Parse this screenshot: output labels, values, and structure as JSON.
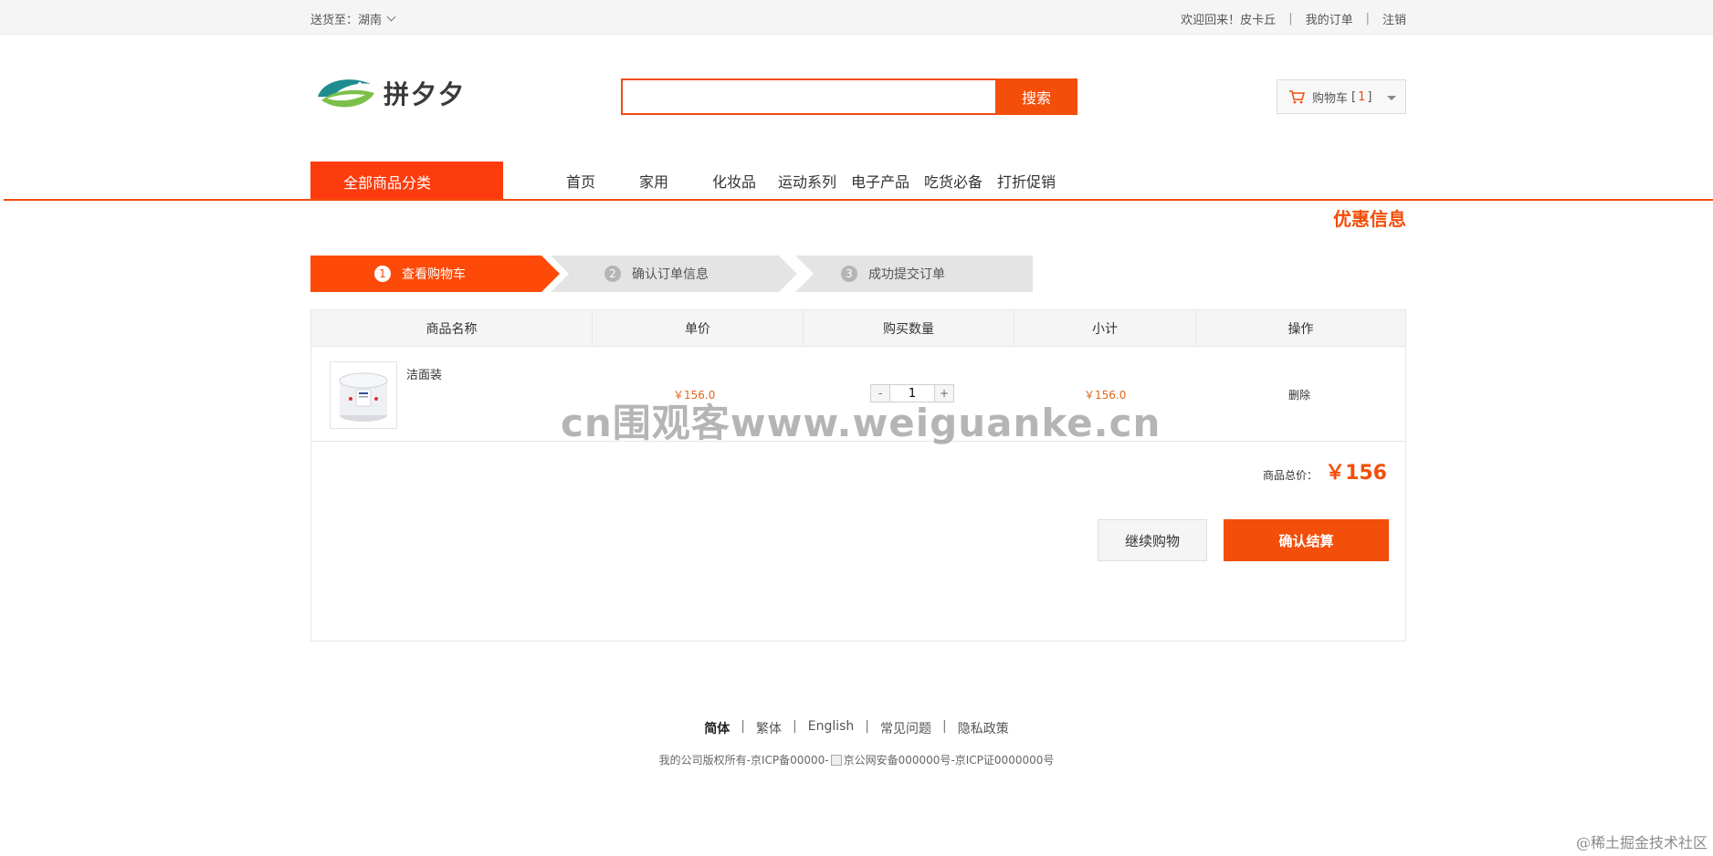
{
  "topbar": {
    "ship_to": "送货至：湖南",
    "welcome": "欢迎回来！皮卡丘",
    "my_orders": "我的订单",
    "logout": "注销",
    "sep": "|"
  },
  "header": {
    "logo_text": "拼夕夕",
    "search_placeholder": "",
    "search_button": "搜索",
    "cart_label": "购物车",
    "cart_count_open": "[",
    "cart_count": "1",
    "cart_count_close": "]"
  },
  "nav": {
    "all_categories": "全部商品分类",
    "items": [
      "首页",
      "家用",
      "化妆品",
      "运动系列",
      "电子产品",
      "吃货必备",
      "打折促销"
    ]
  },
  "promo_title": "优惠信息",
  "steps": [
    {
      "num": "1",
      "label": "查看购物车",
      "active": true
    },
    {
      "num": "2",
      "label": "确认订单信息",
      "active": false
    },
    {
      "num": "3",
      "label": "成功提交订单",
      "active": false
    }
  ],
  "table": {
    "headers": [
      "商品名称",
      "单价",
      "购买数量",
      "小计",
      "操作"
    ],
    "rows": [
      {
        "name": "洁面装",
        "price": "￥156.0",
        "qty": "1",
        "subtotal": "￥156.0",
        "action": "删除"
      }
    ],
    "qty_minus": "-",
    "qty_plus": "+"
  },
  "summary": {
    "total_label": "商品总价：",
    "total_value": "￥156",
    "continue_button": "继续购物",
    "confirm_button": "确认结算"
  },
  "watermark": "cn围观客www.weiguanke.cn",
  "footer": {
    "links": [
      "简体",
      "繁体",
      "English",
      "常见问题",
      "隐私政策"
    ],
    "sep": "|",
    "copy_prefix": "我的公司版权所有-京ICP备00000-",
    "copy_mid": "京公网安备000000号",
    "copy_suffix": "-京ICP证0000000号"
  },
  "corner_mark": "@稀土掘金技术社区",
  "colors": {
    "accent": "#f34e0a",
    "price": "#e1671b",
    "step_active": "#fd4a09",
    "step_inactive": "#e4e4e4"
  }
}
